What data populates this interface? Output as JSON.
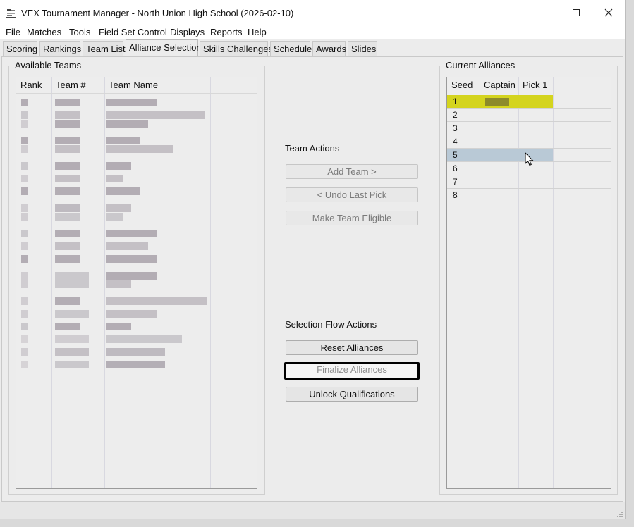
{
  "window": {
    "title": "VEX Tournament Manager - North Union High School (2026-02-10)"
  },
  "menu": [
    "File",
    "Matches",
    "Tools",
    "Field Set Control",
    "Displays",
    "Reports",
    "Help"
  ],
  "tabs": [
    "Scoring",
    "Rankings",
    "Team List",
    "Alliance Selection",
    "Skills Challenges",
    "Schedule",
    "Awards",
    "Slides"
  ],
  "active_tab": "Alliance Selection",
  "available_teams": {
    "title": "Available Teams",
    "columns": [
      "Rank",
      "Team #",
      "Team Name"
    ]
  },
  "team_actions": {
    "title": "Team Actions",
    "add_team": "Add Team >",
    "undo_last_pick": "< Undo Last Pick",
    "make_team_eligible": "Make Team Eligible"
  },
  "selection_flow": {
    "title": "Selection Flow Actions",
    "reset_alliances": "Reset Alliances",
    "finalize_alliances": "Finalize Alliances",
    "unlock_qualifications": "Unlock Qualifications"
  },
  "current_alliances": {
    "title": "Current Alliances",
    "columns": [
      "Seed",
      "Captain",
      "Pick 1"
    ],
    "seeds": [
      "1",
      "2",
      "3",
      "4",
      "5",
      "6",
      "7",
      "8"
    ],
    "highlight_color": "#d4d41e",
    "selected_color": "#b9c9d6"
  }
}
